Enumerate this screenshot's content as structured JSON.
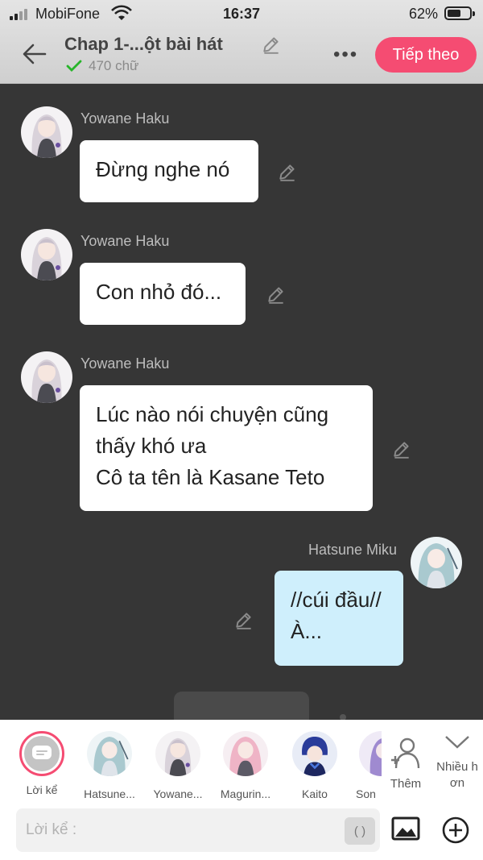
{
  "status_bar": {
    "carrier": "MobiFone",
    "time": "16:37",
    "battery_percent": "62%",
    "battery_level": 0.62
  },
  "header": {
    "title": "Chap 1-...ột bài hát",
    "word_count": "470 chữ",
    "next_label": "Tiếp theo"
  },
  "messages": [
    {
      "sender": "Yowane Haku",
      "text": "Đừng nghe nó"
    },
    {
      "sender": "Yowane Haku",
      "text": "Con nhỏ đó..."
    },
    {
      "sender": "Yowane Haku",
      "text": "Lúc nào nói chuyện cũng\nthấy khó ưa\nCô ta tên là Kasane Teto"
    },
    {
      "sender": "Hatsune Miku",
      "text": "//cúi đầu//\nÀ..."
    }
  ],
  "characters": [
    {
      "label": "Lời kể"
    },
    {
      "label": "Hatsune..."
    },
    {
      "label": "Yowane..."
    },
    {
      "label": "Magurin..."
    },
    {
      "label": "Kaito"
    },
    {
      "label": "Son"
    }
  ],
  "add_label": "Thêm",
  "more_label": "Nhiều h\nơn",
  "composer": {
    "placeholder": "Lời kể :",
    "paren": "( )"
  },
  "colors": {
    "accent": "#f54c72",
    "chat_bg": "#363636",
    "my_bubble": "#cfeffc"
  }
}
